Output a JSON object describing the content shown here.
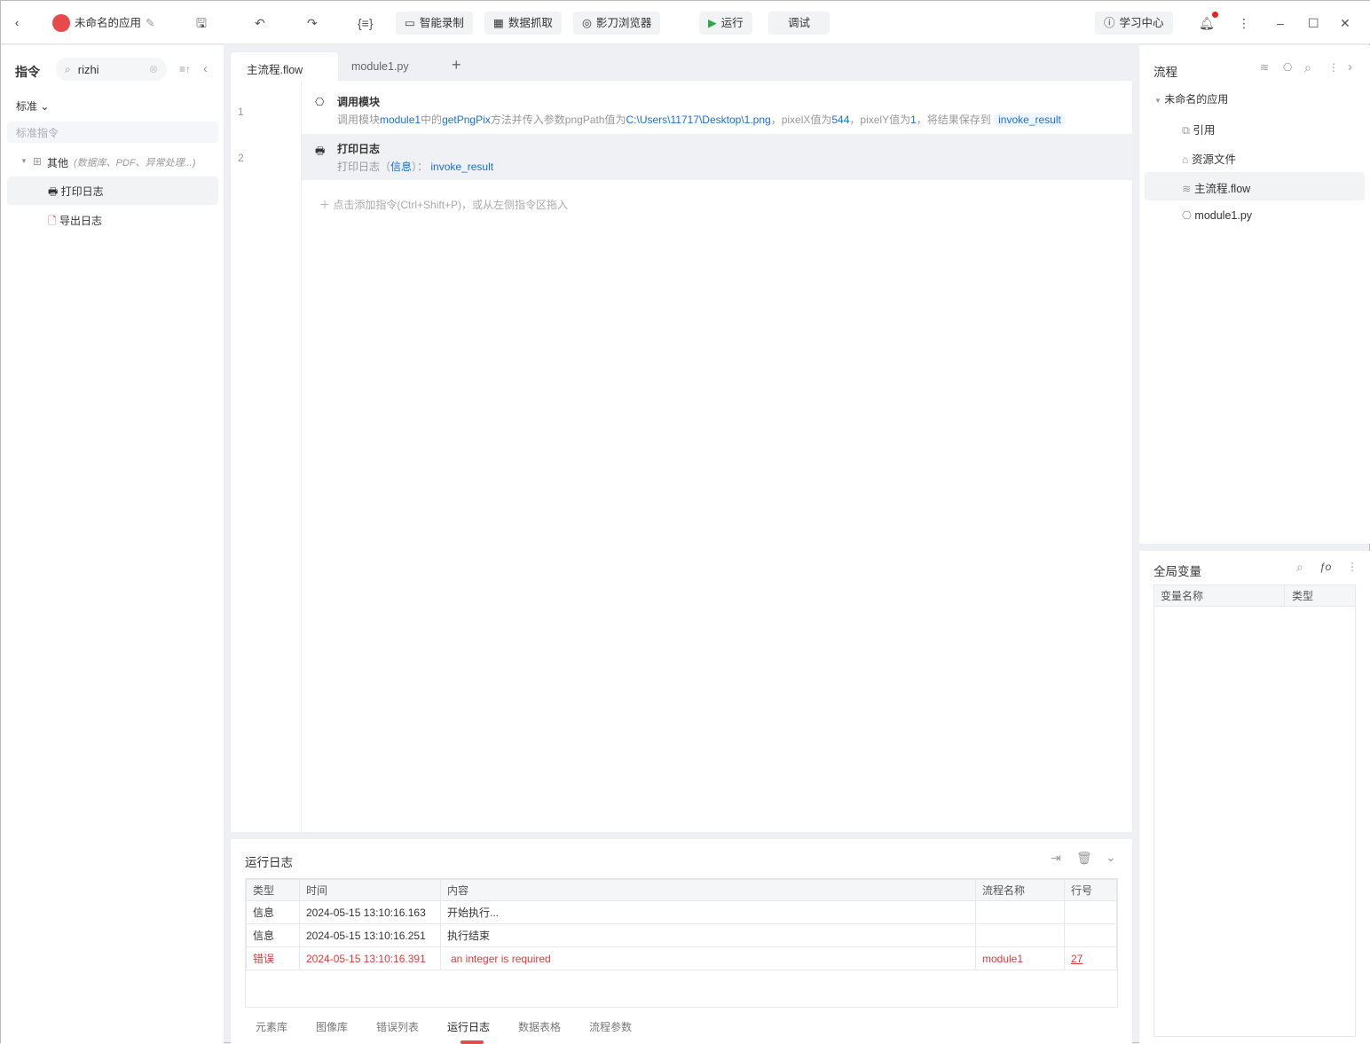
{
  "topbar": {
    "app_name": "未命名的应用",
    "record": "智能录制",
    "scrape": "数据抓取",
    "browser": "影刀浏览器",
    "run": "运行",
    "debug": "调试",
    "learn": "学习中心",
    "accent": "#e84a4a"
  },
  "left": {
    "title": "指令",
    "search_value": "rizhi",
    "category": "标准",
    "section": "标准指令",
    "group": "其他",
    "group_hint": "(数据库、PDF、异常处理...)",
    "items": [
      "打印日志",
      "导出日志"
    ]
  },
  "editor": {
    "tabs": [
      "主流程.flow",
      "module1.py"
    ],
    "lines": [
      {
        "no": "1",
        "title": "调用模块",
        "p1": "调用模块",
        "module": "module1",
        "p2": "中的",
        "method": "getPngPix",
        "p3": "方法并传入参数pngPath值为",
        "path": "C:\\Users\\11717\\Desktop\\1.png",
        "p4": "，pixelX值为",
        "x": "544",
        "p5": "，pixelY值为",
        "y": "1",
        "p6": "，将结果保存到",
        "var": "invoke_result"
      },
      {
        "no": "2",
        "title": "打印日志",
        "p1": "打印日志（",
        "level": "信息",
        "p2": "）：",
        "var": "invoke_result"
      }
    ],
    "add_hint": "点击添加指令(Ctrl+Shift+P)，或从左侧指令区拖入"
  },
  "log": {
    "title": "运行日志",
    "columns": [
      "类型",
      "时间",
      "内容",
      "流程名称",
      "行号"
    ],
    "rows": [
      {
        "type": "信息",
        "time": "2024-05-15 13:10:16.163",
        "content": "开始执行...",
        "flow": "",
        "line": ""
      },
      {
        "type": "信息",
        "time": "2024-05-15 13:10:16.251",
        "content": "执行结束",
        "flow": "",
        "line": ""
      },
      {
        "type": "错误",
        "time": "2024-05-15 13:10:16.391",
        "content": "an integer is required",
        "flow": "module1",
        "line": "27"
      }
    ],
    "tabs": [
      "元素库",
      "图像库",
      "错误列表",
      "运行日志",
      "数据表格",
      "流程参数"
    ],
    "active_tab": "运行日志"
  },
  "right": {
    "title": "流程",
    "root": "未命名的应用",
    "items": [
      "引用",
      "资源文件",
      "主流程.flow",
      "module1.py"
    ],
    "vars_title": "全局变量",
    "var_columns": [
      "变量名称",
      "类型"
    ]
  }
}
